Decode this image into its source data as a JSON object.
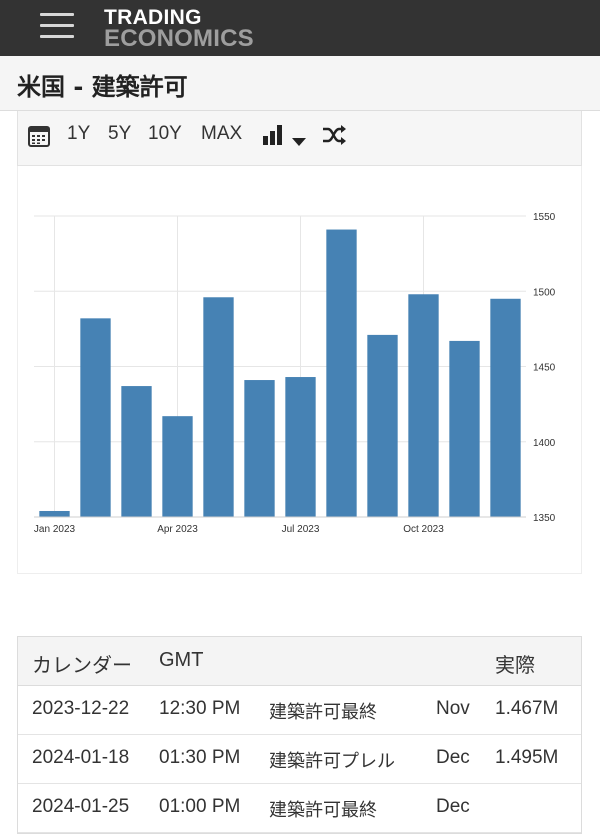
{
  "header": {
    "logo_line1": "TRADING",
    "logo_line2": "ECONOMICS"
  },
  "page": {
    "title": "米国 - 建築許可"
  },
  "toolbar": {
    "ranges": [
      "1Y",
      "5Y",
      "10Y",
      "MAX"
    ]
  },
  "chart_data": {
    "type": "bar",
    "categories": [
      "Jan 2023",
      "Feb 2023",
      "Mar 2023",
      "Apr 2023",
      "May 2023",
      "Jun 2023",
      "Jul 2023",
      "Aug 2023",
      "Sep 2023",
      "Oct 2023",
      "Nov 2023",
      "Dec 2023"
    ],
    "values": [
      1354,
      1482,
      1437,
      1417,
      1496,
      1441,
      1443,
      1541,
      1471,
      1498,
      1467,
      1495
    ],
    "x_tick_labels": [
      "Jan 2023",
      "Apr 2023",
      "Jul 2023",
      "Oct 2023"
    ],
    "y_ticks": [
      1350,
      1400,
      1450,
      1500,
      1550
    ],
    "ylim": [
      1350,
      1550
    ],
    "bar_color": "#4682b4",
    "grid": true,
    "y_axis_side": "right"
  },
  "calendar": {
    "headers": {
      "calendar": "カレンダー",
      "gmt": "GMT",
      "actual": "実際"
    },
    "rows": [
      {
        "date": "2023-12-22",
        "time": "12:30 PM",
        "event": "建築許可最終",
        "period": "Nov",
        "actual": "1.467M"
      },
      {
        "date": "2024-01-18",
        "time": "01:30 PM",
        "event": "建築許可プレル",
        "period": "Dec",
        "actual": "1.495M"
      },
      {
        "date": "2024-01-25",
        "time": "01:00 PM",
        "event": "建築許可最終",
        "period": "Dec",
        "actual": ""
      }
    ]
  }
}
